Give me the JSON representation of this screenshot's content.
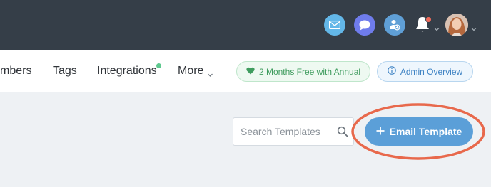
{
  "topbar": {
    "icons": [
      "mail-icon",
      "chat-icon",
      "user-add-icon",
      "bell-icon",
      "avatar"
    ],
    "colors": {
      "background": "#353e48",
      "mail": "#63b7e8",
      "chat": "#6f7cec",
      "user": "#5f9fd6",
      "notification_dot": "#ef6a5a"
    }
  },
  "nav": {
    "items": [
      {
        "label": "mbers"
      },
      {
        "label": "Tags"
      },
      {
        "label": "Integrations"
      },
      {
        "label": "More"
      }
    ],
    "promo_label": "2 Months Free with Annual",
    "admin_label": "Admin Overview",
    "colors": {
      "promo": "#3f9c5e",
      "admin": "#3f83c4",
      "integrations_dot": "#5fc98f"
    }
  },
  "content": {
    "search_placeholder": "Search Templates",
    "add_button_label": "Email Template",
    "colors": {
      "add_button": "#5b9fd8",
      "highlight_ring": "#e8694c"
    }
  }
}
